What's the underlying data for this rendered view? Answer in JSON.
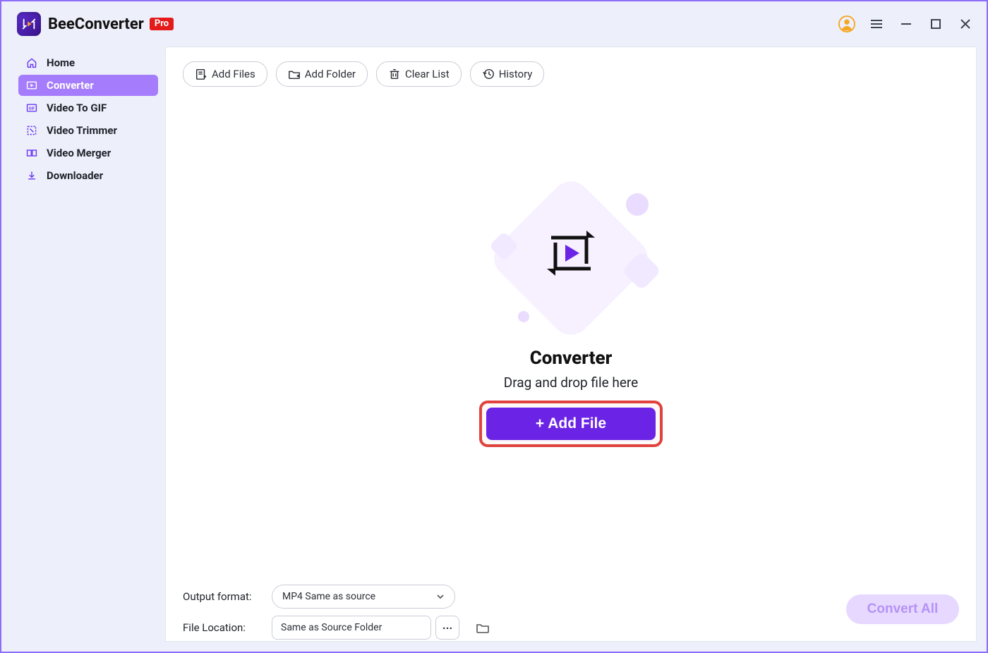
{
  "app": {
    "name": "BeeConverter",
    "badge": "Pro"
  },
  "sidebar": {
    "items": [
      {
        "label": "Home",
        "icon": "home",
        "active": false,
        "name": "sidebar-item-home"
      },
      {
        "label": "Converter",
        "icon": "converter",
        "active": true,
        "name": "sidebar-item-converter"
      },
      {
        "label": "Video To GIF",
        "icon": "gif",
        "active": false,
        "name": "sidebar-item-video-to-gif"
      },
      {
        "label": "Video Trimmer",
        "icon": "trim",
        "active": false,
        "name": "sidebar-item-video-trimmer"
      },
      {
        "label": "Video Merger",
        "icon": "merge",
        "active": false,
        "name": "sidebar-item-video-merger"
      },
      {
        "label": "Downloader",
        "icon": "download",
        "active": false,
        "name": "sidebar-item-downloader"
      }
    ]
  },
  "toolbar": {
    "add_files_label": "Add Files",
    "add_folder_label": "Add Folder",
    "clear_list_label": "Clear List",
    "history_label": "History"
  },
  "empty_state": {
    "title": "Converter",
    "subtitle": "Drag and drop file here",
    "button_label": "+ Add File"
  },
  "bottom": {
    "output_format_label": "Output format:",
    "output_format_value": "MP4 Same as source",
    "file_location_label": "File Location:",
    "file_location_value": "Same as Source Folder"
  },
  "convert_all_label": "Convert All",
  "colors": {
    "accent": "#6b24e6",
    "sidebar_active": "#a57cfb",
    "highlight": "#e0433e",
    "badge_red": "#e41b1b",
    "user_accent": "#f5a623"
  }
}
